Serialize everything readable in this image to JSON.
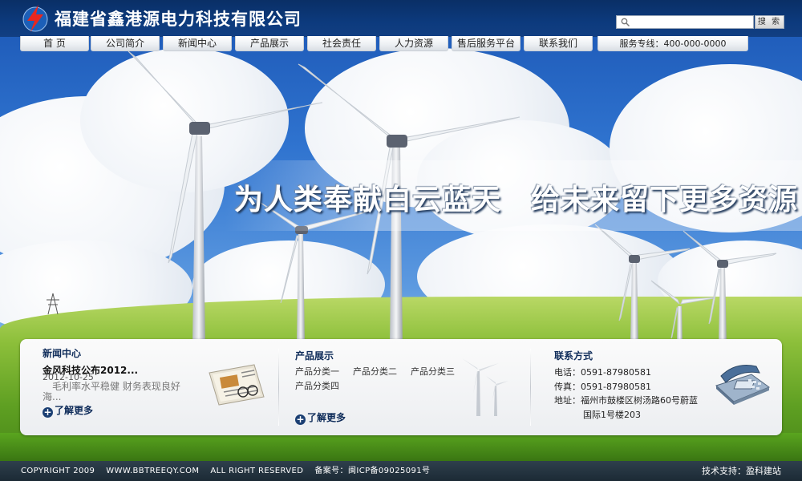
{
  "header": {
    "company_name": "福建省鑫港源电力科技有限公司",
    "search_button": "搜 索",
    "search_placeholder": ""
  },
  "nav": {
    "items": [
      "首 页",
      "公司简介",
      "新闻中心",
      "产品展示",
      "社会责任",
      "人力资源",
      "售后服务平台",
      "联系我们",
      "服务专线：400-000-0000"
    ]
  },
  "banner": {
    "slogan": "为人类奉献白云蓝天　给未来留下更多资源"
  },
  "news": {
    "title": "新闻中心",
    "headline": "金风科技公布2012...",
    "date": "2012-10-25",
    "summary": "　毛利率水平稳健 财务表现良好海...",
    "more": "了解更多"
  },
  "products": {
    "title": "产品展示",
    "categories": [
      "产品分类一",
      "产品分类二",
      "产品分类三",
      "产品分类四"
    ],
    "more": "了解更多"
  },
  "contact": {
    "title": "联系方式",
    "phone": "电话：0591-87980581",
    "fax": "传真：0591-87980581",
    "address_line1": "地址：福州市鼓楼区树汤路60号蔚蓝",
    "address_line2": "国际1号楼203"
  },
  "footer": {
    "copyright": "COPYRIGHT 2009　 WWW.BBTREEQY.COM　 ALL RIGHT RESERVED　 备案号：闽ICP备09025091号",
    "support": "技术支持：盈科建站"
  },
  "colors": {
    "header_bg": "#0c3a7d",
    "footer_bg": "#26353f",
    "accent_text": "#0f2c5a"
  }
}
